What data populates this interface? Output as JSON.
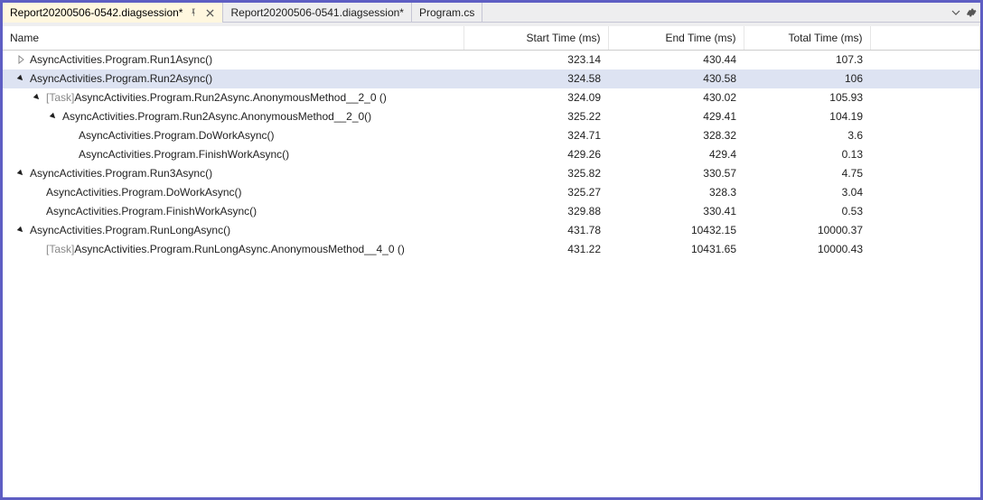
{
  "tabs": [
    {
      "label": "Report20200506-0542.diagsession*",
      "active": true,
      "pinned": true,
      "close": true
    },
    {
      "label": "Report20200506-0541.diagsession*",
      "active": false,
      "pinned": false,
      "close": false
    },
    {
      "label": "Program.cs",
      "active": false,
      "pinned": false,
      "close": false
    }
  ],
  "columns": {
    "name": "Name",
    "start": "Start Time (ms)",
    "end": "End Time (ms)",
    "total": "Total Time (ms)"
  },
  "rows": [
    {
      "indent": 0,
      "expander": "collapsed",
      "task": false,
      "name": "AsyncActivities.Program.Run1Async()",
      "start": "323.14",
      "end": "430.44",
      "total": "107.3",
      "selected": false
    },
    {
      "indent": 0,
      "expander": "expanded",
      "task": false,
      "name": "AsyncActivities.Program.Run2Async()",
      "start": "324.58",
      "end": "430.58",
      "total": "106",
      "selected": true
    },
    {
      "indent": 1,
      "expander": "expanded",
      "task": true,
      "name": "AsyncActivities.Program.Run2Async.AnonymousMethod__2_0 ()",
      "start": "324.09",
      "end": "430.02",
      "total": "105.93",
      "selected": false
    },
    {
      "indent": 2,
      "expander": "expanded",
      "task": false,
      "name": "AsyncActivities.Program.Run2Async.AnonymousMethod__2_0()",
      "start": "325.22",
      "end": "429.41",
      "total": "104.19",
      "selected": false
    },
    {
      "indent": 3,
      "expander": "none",
      "task": false,
      "name": "AsyncActivities.Program.DoWorkAsync()",
      "start": "324.71",
      "end": "328.32",
      "total": "3.6",
      "selected": false
    },
    {
      "indent": 3,
      "expander": "none",
      "task": false,
      "name": "AsyncActivities.Program.FinishWorkAsync()",
      "start": "429.26",
      "end": "429.4",
      "total": "0.13",
      "selected": false
    },
    {
      "indent": 0,
      "expander": "expanded",
      "task": false,
      "name": "AsyncActivities.Program.Run3Async()",
      "start": "325.82",
      "end": "330.57",
      "total": "4.75",
      "selected": false
    },
    {
      "indent": 1,
      "expander": "none",
      "task": false,
      "name": "AsyncActivities.Program.DoWorkAsync()",
      "start": "325.27",
      "end": "328.3",
      "total": "3.04",
      "selected": false
    },
    {
      "indent": 1,
      "expander": "none",
      "task": false,
      "name": "AsyncActivities.Program.FinishWorkAsync()",
      "start": "329.88",
      "end": "330.41",
      "total": "0.53",
      "selected": false
    },
    {
      "indent": 0,
      "expander": "expanded",
      "task": false,
      "name": "AsyncActivities.Program.RunLongAsync()",
      "start": "431.78",
      "end": "10432.15",
      "total": "10000.37",
      "selected": false
    },
    {
      "indent": 1,
      "expander": "none",
      "task": true,
      "name": "AsyncActivities.Program.RunLongAsync.AnonymousMethod__4_0 ()",
      "start": "431.22",
      "end": "10431.65",
      "total": "10000.43",
      "selected": false
    }
  ],
  "task_prefix": "[Task] "
}
